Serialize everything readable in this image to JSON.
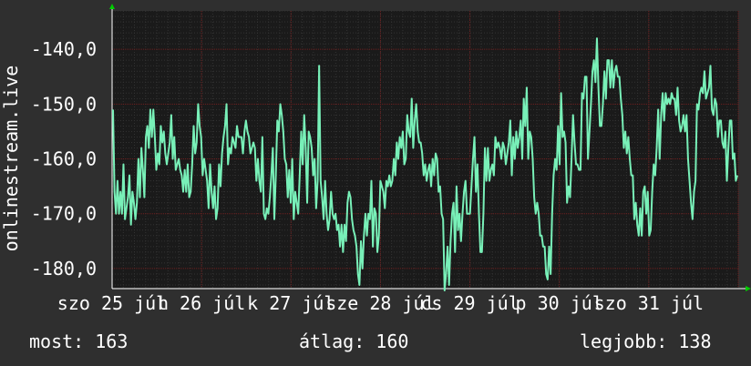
{
  "chart_data": {
    "type": "line",
    "ylabel": "onlinestream.live",
    "ylim": [
      -183.5,
      -133.0
    ],
    "yticks": [
      -140,
      -150,
      -160,
      -170,
      -180
    ],
    "ytick_labels": [
      "-140,0",
      "-150,0",
      "-160,0",
      "-170,0",
      "-180,0"
    ],
    "xtick_labels": [
      "szo 25 júl",
      "h 26 júl",
      "k 27 júl",
      "sze 28 júl",
      "cs 29 júl",
      "p 30 júl",
      "szo 31 júl"
    ],
    "colors": {
      "background": "#2f2f2f",
      "plot_background": "#1a1a1a",
      "grid_minor": "#333333",
      "grid_major": "#6e1e1e",
      "line": "#78f0b8",
      "axis": "#ffffff",
      "arrow": "#00cc00"
    },
    "grid": true,
    "series": [
      {
        "values": [
          -151,
          -166,
          -170,
          -164,
          -170,
          -166,
          -170,
          -161,
          -171,
          -169,
          -167,
          -163,
          -172,
          -166,
          -168,
          -171,
          -168,
          -160,
          -167,
          -158,
          -162,
          -167,
          -156,
          -154,
          -158,
          -151,
          -156,
          -151,
          -156,
          -162,
          -159,
          -161,
          -154,
          -157,
          -155,
          -159,
          -161,
          -159,
          -157,
          -152,
          -160,
          -156,
          -162,
          -161,
          -160,
          -162,
          -163,
          -166,
          -162,
          -166,
          -161,
          -167,
          -166,
          -161,
          -154,
          -159,
          -157,
          -150,
          -154,
          -156,
          -163,
          -160,
          -162,
          -164,
          -169,
          -161,
          -166,
          -169,
          -165,
          -171,
          -169,
          -161,
          -165,
          -159,
          -156,
          -154,
          -150,
          -161,
          -158,
          -159,
          -156,
          -157,
          -158,
          -154,
          -156,
          -156,
          -156,
          -159,
          -155,
          -153,
          -155,
          -156,
          -159,
          -158,
          -157,
          -158,
          -164,
          -160,
          -164,
          -166,
          -156,
          -170,
          -171,
          -169,
          -170,
          -167,
          -163,
          -158,
          -171,
          -163,
          -153,
          -155,
          -150,
          -152,
          -155,
          -160,
          -161,
          -167,
          -162,
          -168,
          -160,
          -171,
          -166,
          -168,
          -170,
          -163,
          -155,
          -161,
          -152,
          -158,
          -168,
          -155,
          -156,
          -158,
          -163,
          -160,
          -169,
          -164,
          -143,
          -164,
          -167,
          -171,
          -164,
          -170,
          -173,
          -171,
          -166,
          -170,
          -171,
          -170,
          -173,
          -172,
          -176,
          -172,
          -177,
          -172,
          -175,
          -168,
          -166,
          -167,
          -171,
          -173,
          -174,
          -176,
          -181,
          -183,
          -175,
          -180,
          -174,
          -170,
          -174,
          -170,
          -171,
          -164,
          -176,
          -169,
          -170,
          -177,
          -174,
          -164,
          -165,
          -166,
          -169,
          -164,
          -165,
          -163,
          -165,
          -164,
          -160,
          -163,
          -157,
          -160,
          -156,
          -158,
          -155,
          -161,
          -160,
          -152,
          -155,
          -156,
          -149,
          -158,
          -153,
          -150,
          -155,
          -157,
          -157,
          -159,
          -163,
          -161,
          -164,
          -162,
          -161,
          -165,
          -160,
          -163,
          -159,
          -160,
          -166,
          -165,
          -170,
          -171,
          -184,
          -181,
          -176,
          -183,
          -175,
          -170,
          -168,
          -177,
          -165,
          -173,
          -170,
          -175,
          -170,
          -166,
          -164,
          -170,
          -170,
          -170,
          -165,
          -160,
          -156,
          -166,
          -161,
          -170,
          -177,
          -177,
          -170,
          -158,
          -164,
          -158,
          -164,
          -162,
          -161,
          -163,
          -156,
          -158,
          -157,
          -158,
          -160,
          -157,
          -158,
          -161,
          -159,
          -157,
          -153,
          -163,
          -156,
          -160,
          -155,
          -158,
          -156,
          -153,
          -160,
          -149,
          -154,
          -147,
          -160,
          -155,
          -156,
          -160,
          -167,
          -170,
          -168,
          -170,
          -174,
          -174,
          -176,
          -176,
          -181,
          -182,
          -176,
          -181,
          -170,
          -163,
          -160,
          -162,
          -154,
          -161,
          -148,
          -156,
          -155,
          -157,
          -168,
          -165,
          -167,
          -160,
          -152,
          -157,
          -161,
          -161,
          -162,
          -162,
          -148,
          -149,
          -145,
          -145,
          -160,
          -155,
          -150,
          -144,
          -142,
          -146,
          -138,
          -147,
          -154,
          -154,
          -150,
          -144,
          -149,
          -142,
          -142,
          -147,
          -142,
          -147,
          -144,
          -143,
          -145,
          -145,
          -149,
          -152,
          -158,
          -155,
          -159,
          -156,
          -160,
          -163,
          -163,
          -171,
          -168,
          -172,
          -174,
          -169,
          -174,
          -166,
          -165,
          -170,
          -166,
          -174,
          -173,
          -166,
          -161,
          -163,
          -158,
          -151,
          -160,
          -152,
          -148,
          -153,
          -148,
          -150,
          -149,
          -150,
          -148,
          -149,
          -149,
          -152,
          -147,
          -153,
          -155,
          -154,
          -152,
          -155,
          -152,
          -160,
          -164,
          -168,
          -171,
          -166,
          -164,
          -150,
          -151,
          -148,
          -147,
          -148,
          -144,
          -149,
          -148,
          -147,
          -143,
          -151,
          -152,
          -149,
          -150,
          -156,
          -153,
          -153,
          -157,
          -158,
          -155,
          -164,
          -158,
          -153,
          -153,
          -160,
          -159,
          -164,
          -163
        ]
      }
    ],
    "yaxis_arrow": true,
    "xaxis_arrow": true
  },
  "stats": {
    "current": "most: 163",
    "average": "átlag: 160",
    "best": "legjobb: 138"
  }
}
